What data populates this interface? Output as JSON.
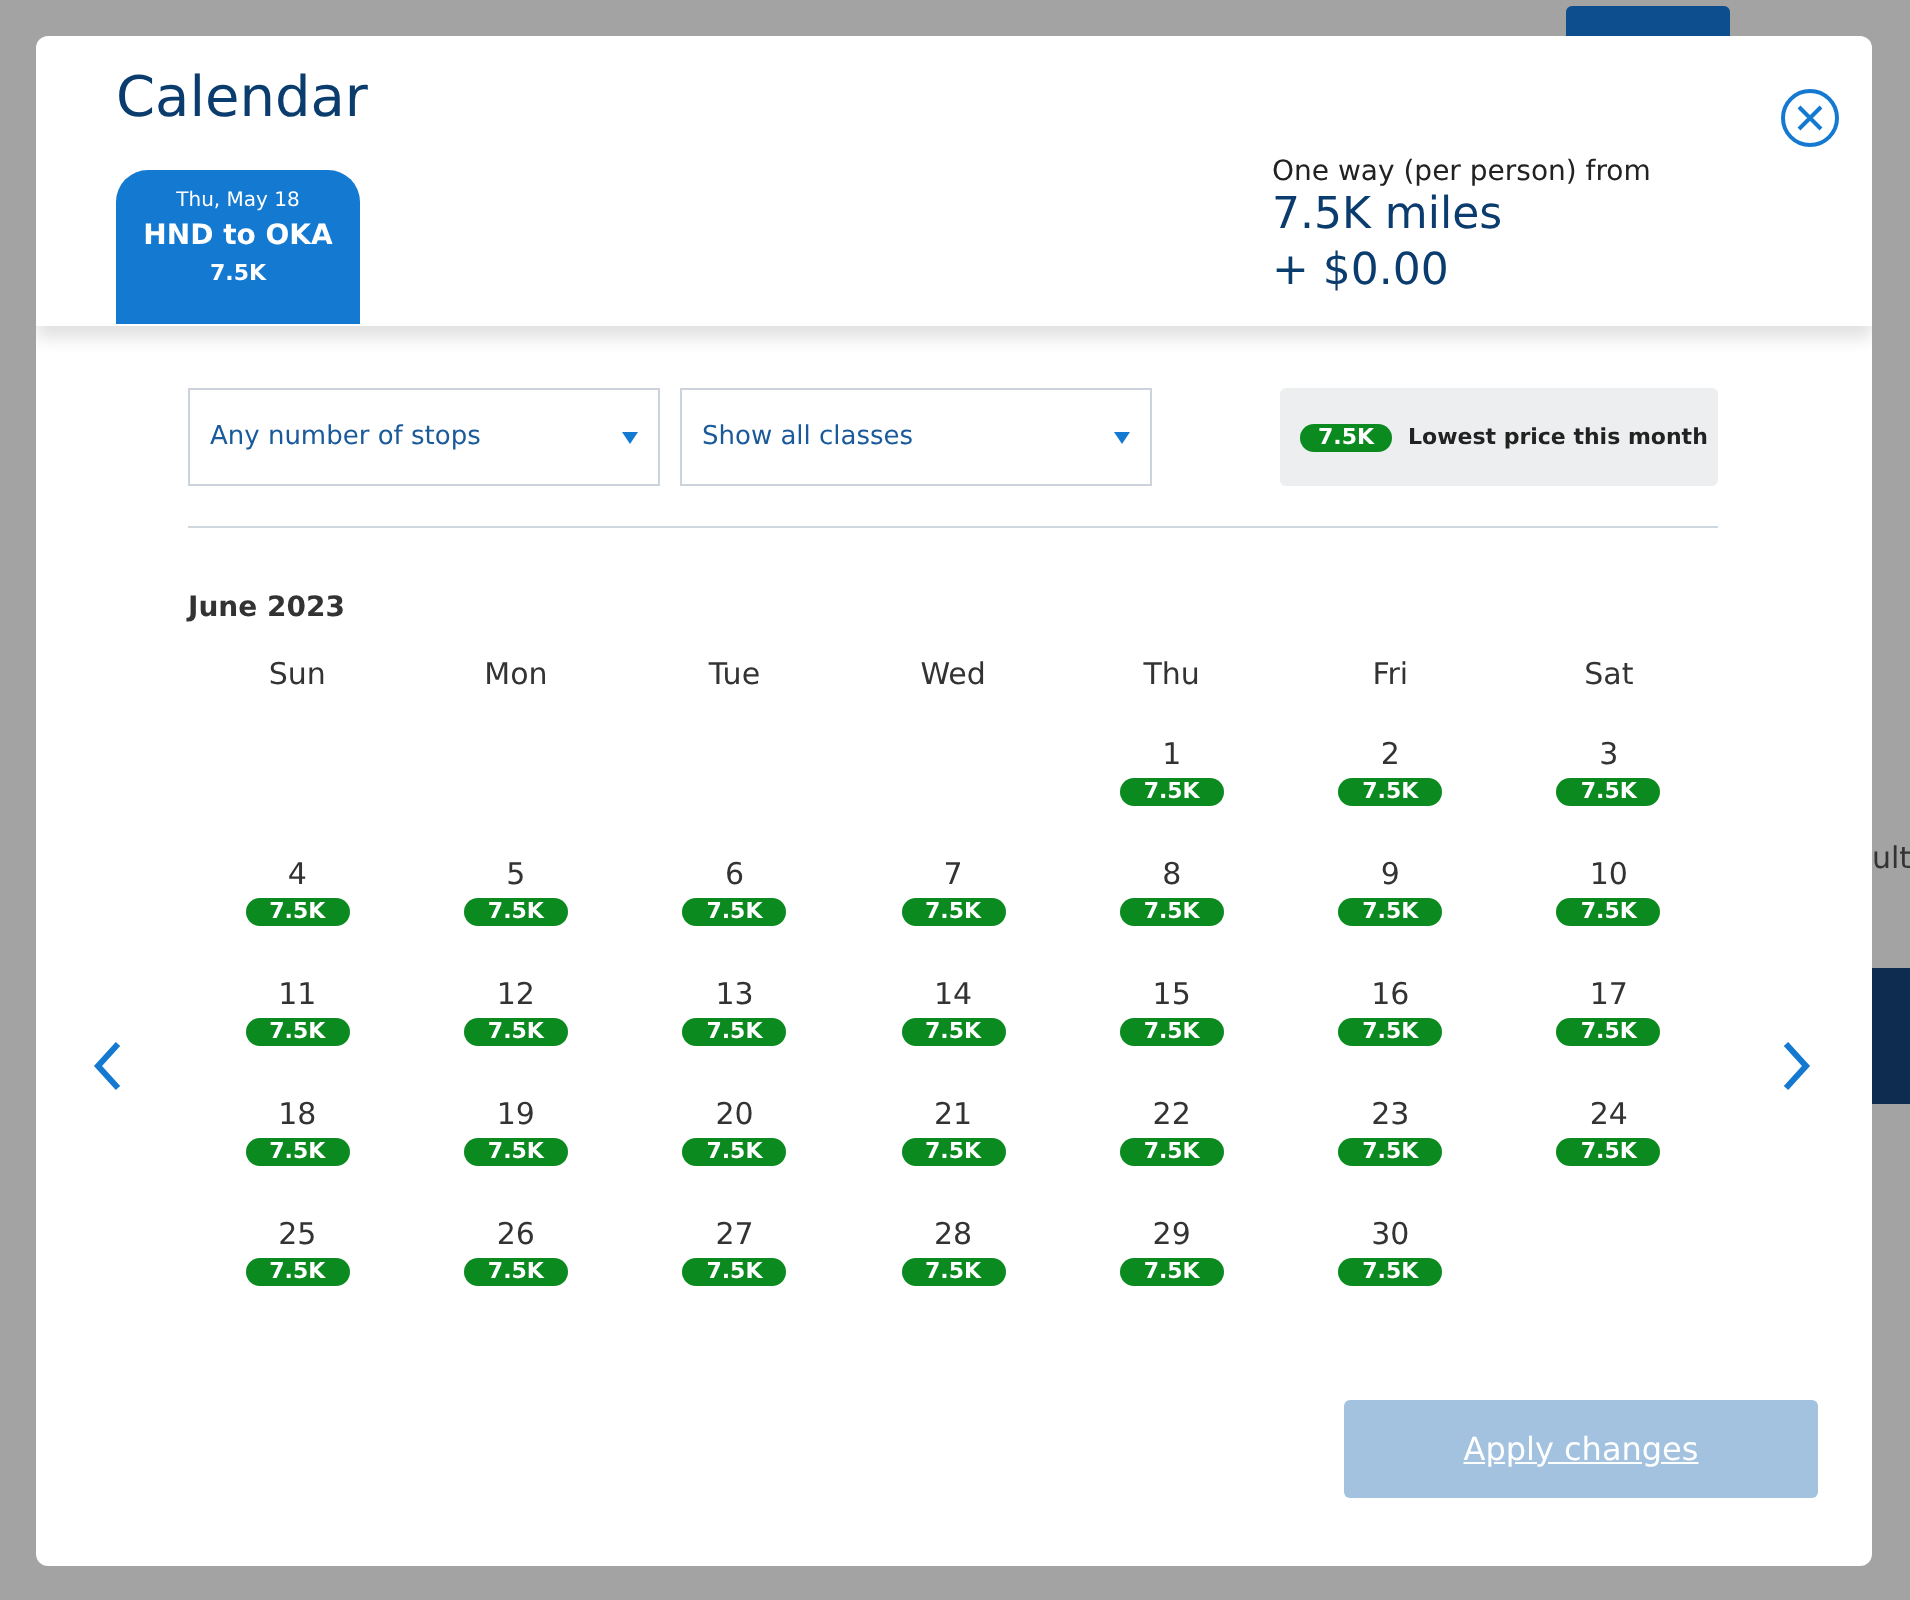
{
  "background_page": {
    "right_fragment": "ult"
  },
  "dialog": {
    "title": "Calendar",
    "flight_tab": {
      "date": "Thu, May 18",
      "route": "HND to OKA",
      "price": "7.5K",
      "selected": true
    },
    "fare": {
      "label": "One way (per person) from",
      "miles": "7.5K miles",
      "cash": "+ $0.00"
    },
    "filters": [
      {
        "value": "Any number of stops"
      },
      {
        "value": "Show all classes"
      }
    ],
    "legend": {
      "badge": "7.5K",
      "label": "Lowest price this month"
    },
    "month": "June 2023",
    "weekdays": [
      "Sun",
      "Mon",
      "Tue",
      "Wed",
      "Thu",
      "Fri",
      "Sat"
    ],
    "days": [
      {
        "day": "1",
        "price": "7.5K"
      },
      {
        "day": "2",
        "price": "7.5K"
      },
      {
        "day": "3",
        "price": "7.5K"
      },
      {
        "day": "4",
        "price": "7.5K"
      },
      {
        "day": "5",
        "price": "7.5K"
      },
      {
        "day": "6",
        "price": "7.5K"
      },
      {
        "day": "7",
        "price": "7.5K"
      },
      {
        "day": "8",
        "price": "7.5K"
      },
      {
        "day": "9",
        "price": "7.5K"
      },
      {
        "day": "10",
        "price": "7.5K"
      },
      {
        "day": "11",
        "price": "7.5K"
      },
      {
        "day": "12",
        "price": "7.5K"
      },
      {
        "day": "13",
        "price": "7.5K"
      },
      {
        "day": "14",
        "price": "7.5K"
      },
      {
        "day": "15",
        "price": "7.5K"
      },
      {
        "day": "16",
        "price": "7.5K"
      },
      {
        "day": "17",
        "price": "7.5K"
      },
      {
        "day": "18",
        "price": "7.5K"
      },
      {
        "day": "19",
        "price": "7.5K"
      },
      {
        "day": "20",
        "price": "7.5K"
      },
      {
        "day": "21",
        "price": "7.5K"
      },
      {
        "day": "22",
        "price": "7.5K"
      },
      {
        "day": "23",
        "price": "7.5K"
      },
      {
        "day": "24",
        "price": "7.5K"
      },
      {
        "day": "25",
        "price": "7.5K"
      },
      {
        "day": "26",
        "price": "7.5K"
      },
      {
        "day": "27",
        "price": "7.5K"
      },
      {
        "day": "28",
        "price": "7.5K"
      },
      {
        "day": "29",
        "price": "7.5K"
      },
      {
        "day": "30",
        "price": "7.5K"
      }
    ],
    "apply_button": {
      "label": "Apply changes",
      "disabled": true
    }
  }
}
